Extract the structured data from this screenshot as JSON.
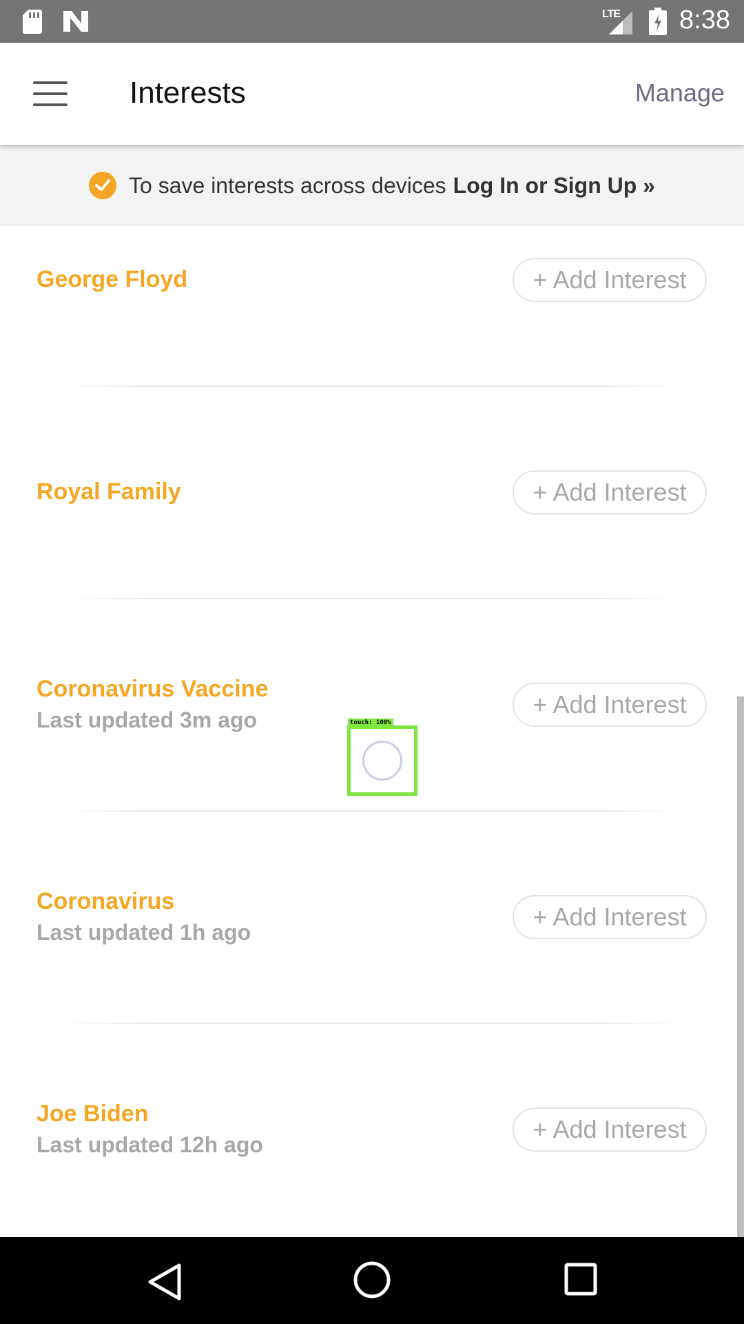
{
  "status_bar": {
    "time": "8:38",
    "network": "LTE",
    "icons": [
      "sd-card-icon",
      "n-notification-icon",
      "signal-icon",
      "battery-charging-icon"
    ]
  },
  "header": {
    "title": "Interests",
    "manage_label": "Manage",
    "menu_icon": "hamburger-menu-icon"
  },
  "banner": {
    "text": "To save interests across devices",
    "link": "Log In or Sign Up »",
    "icon": "check-circle-icon",
    "accent": "#f5a623"
  },
  "interests": [
    {
      "title": "George Floyd",
      "subtitle": "",
      "button": "+ Add Interest"
    },
    {
      "title": "Royal Family",
      "subtitle": "",
      "button": "+ Add Interest"
    },
    {
      "title": "Coronavirus Vaccine",
      "subtitle": "Last updated 3m ago",
      "button": "+ Add Interest"
    },
    {
      "title": "Coronavirus",
      "subtitle": "Last updated 1h ago",
      "button": "+ Add Interest"
    },
    {
      "title": "Joe Biden",
      "subtitle": "Last updated 12h ago",
      "button": "+ Add Interest"
    }
  ],
  "touch_overlay": {
    "label": "touch: 100%"
  },
  "nav_bar": {
    "icons": [
      "back-icon",
      "home-icon",
      "recents-icon"
    ]
  }
}
